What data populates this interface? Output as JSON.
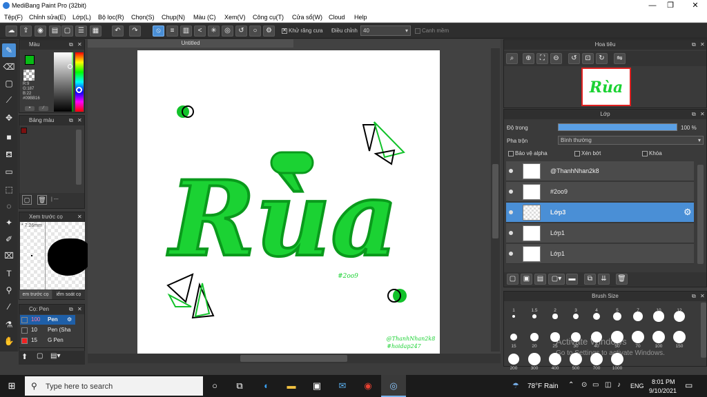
{
  "window": {
    "title": "MediBang Paint Pro (32bit)"
  },
  "menu": [
    "Tệp(F)",
    "Chỉnh sửa(E)",
    "Lớp(L)",
    "Bộ lọc(R)",
    "Chọn(S)",
    "Chụp(N)",
    "Màu (C)",
    "Xem(V)",
    "Công cụ(T)",
    "Cửa sổ(W)",
    "Cloud",
    "Help"
  ],
  "toolbar": {
    "antialias_label": "Khử răng cưa",
    "adjust_label": "Điều chỉnh",
    "adjust_value": "40",
    "correction_label": "Canh mềm"
  },
  "color_panel": {
    "title": "Màu",
    "r": "R:9",
    "g": "G:187",
    "b": "B:22",
    "hex": "#09BB16",
    "primary_color": "#09BB16"
  },
  "palette_panel": {
    "title": "Bảng màu",
    "count": "| ---"
  },
  "preview_panel": {
    "title": "Xem trước cọ",
    "size": "7.26mm",
    "tab1": "em trước cọ",
    "tab2": "iểm soát cọ"
  },
  "brush_panel": {
    "title": "Cọ: Pen",
    "items": [
      {
        "size": "100",
        "name": "Pen",
        "color": "#1e5fa8",
        "selected": true
      },
      {
        "size": "10",
        "name": "Pen (Sha",
        "color": "#333333",
        "selected": false
      },
      {
        "size": "15",
        "name": "G Pen",
        "color": "#ee2222",
        "selected": false
      }
    ]
  },
  "document": {
    "tab_title": "Untitled"
  },
  "artwork": {
    "main_text": "Rùa",
    "tag_text": "#2oo9",
    "signature_1": "@ThanhNhan2k8",
    "signature_2": "#hoidap247"
  },
  "navigator_panel": {
    "title": "Hoa tiêu"
  },
  "layer_panel": {
    "title": "Lớp",
    "opacity_label": "Độ trong",
    "opacity_value": "100 %",
    "opacity_fraction": 1.0,
    "blend_label": "Pha trộn",
    "blend_value": "Bình thường",
    "protect_alpha": "Bảo vệ alpha",
    "clip": "Xén bớt",
    "lock": "Khóa",
    "layers": [
      {
        "name": "@ThanhNhan2k8",
        "selected": false
      },
      {
        "name": "#2oo9",
        "selected": false
      },
      {
        "name": "Lớp3",
        "selected": true
      },
      {
        "name": "Lớp1",
        "selected": false
      },
      {
        "name": "Lớp1",
        "selected": false
      }
    ]
  },
  "brush_size_panel": {
    "title": "Brush Size",
    "row1": [
      "1",
      "1.5",
      "2",
      "3",
      "4",
      "5",
      "7",
      "10",
      "12"
    ],
    "row2": [
      "15",
      "20",
      "25",
      "30",
      "40",
      "50",
      "70",
      "100",
      "150"
    ],
    "row3": [
      "200",
      "300",
      "400",
      "500",
      "700",
      "1000"
    ]
  },
  "watermark": {
    "line1": "Activate Windows",
    "line2": "Go to Settings to activate Windows."
  },
  "taskbar": {
    "search_placeholder": "Type here to search",
    "weather": "78°F  Rain",
    "language": "ENG",
    "time": "8:01 PM",
    "date": "9/10/2021"
  }
}
